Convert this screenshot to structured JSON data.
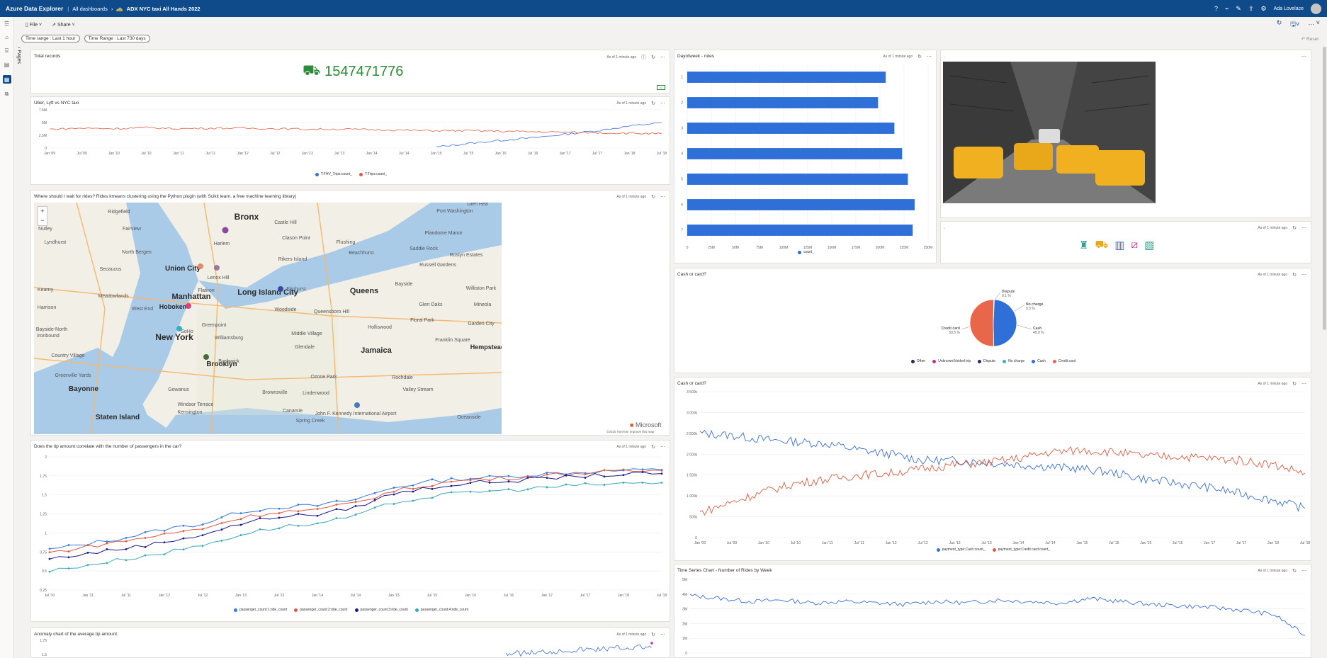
{
  "app": {
    "title": "Azure Data Explorer",
    "breadcrumb_root": "All dashboards",
    "dashboard_name": "ADX NYC taxi All Hands 2022",
    "user": "Ada Lovelace"
  },
  "toolbar": {
    "file": "File",
    "share": "Share"
  },
  "filters": {
    "time_range": "Time range : Last 1 hour",
    "time_range2": "Time Range : Last 730 days",
    "reset": "Reset"
  },
  "rail": {
    "pages": "Pages"
  },
  "tiles": {
    "total": {
      "title": "Total records",
      "meta": "As of 1 minute ago",
      "value": "1547471776"
    },
    "uber": {
      "title": "Uber, Lyft vs NYC taxi",
      "meta": "As of 1 minute ago"
    },
    "map": {
      "title": "Where should I wait for rides? Rides kmeans clustering using the Python plugin (with Scikit learn, a free machine learning library)",
      "meta": "As of 1 minute ago",
      "brand": "Microsoft",
      "copyright": "©2020 TomTom Improve this map"
    },
    "tip": {
      "title": "Does the tip amount correlate with the number of passengers in the car?",
      "meta": "As of 1 minute ago"
    },
    "anomaly": {
      "title": "Anomaly chart of the average tip amount.",
      "meta": "As of 1 minute ago"
    },
    "dow": {
      "title": "Dayofweek - rides",
      "meta": "As of 1 minute ago"
    },
    "image": {
      "title": ".",
      "meta": ""
    },
    "icons": {
      "title": ".",
      "meta": "As of 1 minute ago"
    },
    "pie": {
      "title": "Cash or card?",
      "meta": "As of 1 minute ago"
    },
    "cashline": {
      "title": "Cash or card?",
      "meta": "As of 1 minute ago"
    },
    "weekly": {
      "title": "Time Series Chart - Number of Rides by Week",
      "meta": "As of 1 minute ago"
    }
  },
  "map_labels": [
    "Bronx",
    "Harlem",
    "Manhattan",
    "Union City",
    "Long Island City",
    "Queens",
    "Hoboken",
    "New York",
    "Brooklyn",
    "Jamaica",
    "Bayonne",
    "Staten Island",
    "Castle Hill",
    "Flushing",
    "Elmhurst",
    "Woodside",
    "Port Washington",
    "Plandome Manor",
    "Saddle Rock",
    "Roslyn Estates",
    "Russell Gardens",
    "Beachhurst",
    "Bayside",
    "Glen Oaks",
    "Floral Park",
    "Mineola",
    "Garden City",
    "Franklin Square",
    "Hempstead",
    "Williston Park",
    "Nutley",
    "Lyndhurst",
    "Kearny",
    "Ridgefield",
    "Fairview",
    "Secaucus",
    "North Bergen",
    "Meadowlands",
    "Harrison",
    "West End",
    "Flatiron",
    "Greenpoint",
    "Williamsburg",
    "Middle Village",
    "Glendale",
    "Hollis",
    "Queensboro Hill",
    "Holliswood",
    "Bushwick",
    "Ozone Park",
    "Rochdale",
    "Valley Stream",
    "Brownsville",
    "Lindenwood",
    "Canarsie",
    "Spring Creek",
    "John F. Kennedy International Airport",
    "Oceanside",
    "Kensington",
    "Gowanus",
    "Windsor Terrace",
    "Greenville Yards",
    "Country Village",
    "Bayside-North",
    "Ironbound",
    "Lenox Hill",
    "Rikers Island",
    "Clason Point",
    "SoHo",
    "Bushwick",
    "Glen Hea"
  ],
  "chart_data": [
    {
      "type": "line",
      "title": "Uber, Lyft vs NYC taxi",
      "categories": [
        "Jan '09",
        "Jul '09",
        "Jan '10",
        "Jul '10",
        "Jan '11",
        "Jul '11",
        "Jan '12",
        "Jul '12",
        "Jan '13",
        "Jul '13",
        "Jan '14",
        "Jul '14",
        "Jan '15",
        "Jul '15",
        "Jan '16",
        "Jul '16",
        "Jan '17",
        "Jul '17",
        "Jan '18",
        "Jul '18"
      ],
      "yticks": [
        "7.5M",
        "5M",
        "2.5M",
        "0"
      ],
      "ylim": [
        0,
        7.5
      ],
      "series": [
        {
          "name": "T:FHV_Trips:count_",
          "color": "#3a6fd8",
          "values": [
            null,
            null,
            null,
            null,
            null,
            null,
            null,
            null,
            null,
            null,
            null,
            null,
            0.2,
            0.9,
            1.5,
            2.0,
            2.7,
            3.4,
            4.3,
            5.0
          ]
        },
        {
          "name": "T:Trips:count_",
          "color": "#e05b40",
          "values": [
            3.7,
            3.9,
            3.8,
            4.0,
            3.8,
            3.9,
            3.9,
            3.8,
            3.7,
            3.7,
            3.6,
            3.5,
            3.4,
            3.4,
            3.3,
            3.2,
            3.1,
            3.0,
            2.9,
            2.8
          ]
        }
      ]
    },
    {
      "type": "line",
      "title": "Does the tip amount correlate with the number of passengers in the car?",
      "categories": [
        "Jul '10",
        "Jan '11",
        "Jul '11",
        "Jan '12",
        "Jul '12",
        "Jan '13",
        "Jul '13",
        "Jan '14",
        "Jul '14",
        "Jan '15",
        "Jul '15",
        "Jan '16",
        "Jul '16",
        "Jan '17",
        "Jul '17",
        "Jan '18",
        "Jul '18"
      ],
      "yticks": [
        "2",
        "1.75",
        "1.5",
        "1.25",
        "1",
        "0.75",
        "0.5",
        "0.25"
      ],
      "ylim": [
        0.25,
        2
      ],
      "series": [
        {
          "name": "passenger_count:1:ride_count",
          "color": "#3a7ad8",
          "values": [
            0.78,
            0.86,
            0.94,
            1.05,
            1.12,
            1.28,
            1.34,
            1.36,
            1.44,
            1.6,
            1.68,
            1.72,
            1.74,
            1.78,
            1.8,
            1.82,
            1.83
          ]
        },
        {
          "name": "passenger_count:2:ride_count",
          "color": "#e05b40",
          "values": [
            0.74,
            0.82,
            0.9,
            0.98,
            1.06,
            1.2,
            1.28,
            1.3,
            1.4,
            1.55,
            1.64,
            1.7,
            1.72,
            1.76,
            1.79,
            1.81,
            1.82
          ]
        },
        {
          "name": "passenger_count:3:ride_count",
          "color": "#1a1a8a",
          "values": [
            0.66,
            0.73,
            0.8,
            0.88,
            0.98,
            1.12,
            1.22,
            1.24,
            1.34,
            1.52,
            1.6,
            1.66,
            1.68,
            1.72,
            1.75,
            1.77,
            1.78
          ]
        },
        {
          "name": "passenger_count:4:ride_count",
          "color": "#3aa8b8",
          "values": [
            0.5,
            0.58,
            0.66,
            0.74,
            0.84,
            0.98,
            1.08,
            1.12,
            1.22,
            1.4,
            1.48,
            1.54,
            1.56,
            1.6,
            1.63,
            1.65,
            1.66
          ]
        }
      ]
    },
    {
      "type": "line",
      "title": "Anomaly chart of the average tip amount.",
      "yticks": [
        "1.75",
        "1.5"
      ],
      "ylim": [
        1.4,
        1.8
      ],
      "series": [
        {
          "name": "avg tip",
          "color": "#3a6fd8",
          "values": [
            1.5,
            1.52,
            1.55,
            1.58,
            1.6,
            1.62,
            1.64,
            1.66
          ]
        }
      ]
    },
    {
      "type": "bar",
      "orientation": "horizontal",
      "title": "Dayofweek - rides",
      "categories": [
        "1",
        "2",
        "3",
        "4",
        "5",
        "6",
        "7"
      ],
      "series": [
        {
          "name": "count_",
          "color": "#2f6fd8",
          "values": [
            206,
            198,
            215,
            223,
            229,
            236,
            234
          ]
        }
      ],
      "xticks": [
        "0",
        "25M",
        "50M",
        "75M",
        "100M",
        "125M",
        "150M",
        "175M",
        "200M",
        "225M",
        "250M"
      ],
      "xlim": [
        0,
        250
      ],
      "unit": "M"
    },
    {
      "type": "pie",
      "title": "Cash or card?",
      "slices": [
        {
          "label": "Other",
          "value": 0.0,
          "color": "#3b1f4a"
        },
        {
          "label": "Unknown/Voided trip",
          "value": 0.0,
          "color": "#c0338a"
        },
        {
          "label": "Dispute",
          "value": 0.1,
          "color": "#1f2a6a"
        },
        {
          "label": "No charge",
          "value": 0.3,
          "color": "#3ab0c0"
        },
        {
          "label": "Cash",
          "value": 49.0,
          "color": "#2f6fd8"
        },
        {
          "label": "Credit card",
          "value": 50.5,
          "color": "#e8674a"
        }
      ],
      "callouts": [
        {
          "name": "Dispute",
          "pct": "0.1 %"
        },
        {
          "name": "No charge",
          "pct": "0.3 %"
        },
        {
          "name": "Cash",
          "pct": "49.0 %"
        },
        {
          "name": "Credit card",
          "pct": "50.5 %"
        }
      ]
    },
    {
      "type": "line",
      "title": "Cash or card?",
      "categories": [
        "Jan '09",
        "Jul '09",
        "Jan '10",
        "Jul '10",
        "Jan '11",
        "Jul '11",
        "Jan '12",
        "Jul '12",
        "Jan '13",
        "Jul '13",
        "Jan '14",
        "Jul '14",
        "Jan '15",
        "Jul '15",
        "Jan '16",
        "Jul '16",
        "Jan '17",
        "Jul '17",
        "Jan '18",
        "Jul '18"
      ],
      "yticks": [
        "3 500k",
        "3 000k",
        "2 500k",
        "2 000k",
        "1 500k",
        "1 000k",
        "500k",
        "0"
      ],
      "ylim": [
        0,
        3500
      ],
      "series": [
        {
          "name": "payment_type:Cash:count_",
          "color": "#3a6fd8",
          "values": [
            2500,
            2450,
            2350,
            2300,
            2250,
            2100,
            2000,
            1850,
            1850,
            1800,
            1750,
            1700,
            1650,
            1550,
            1400,
            1300,
            1200,
            1050,
            900,
            700
          ]
        },
        {
          "name": "payment_type:Credit card:count_",
          "color": "#e05b40",
          "values": [
            600,
            850,
            1100,
            1300,
            1400,
            1500,
            1550,
            1650,
            1750,
            1800,
            1900,
            2050,
            2100,
            2050,
            1950,
            1950,
            1900,
            1850,
            1750,
            1550
          ]
        }
      ]
    },
    {
      "type": "line",
      "title": "Time Series Chart - Number of Rides by Week",
      "yticks": [
        "5M",
        "4M",
        "3M",
        "2M",
        "1M",
        "0"
      ],
      "ylim": [
        0,
        5
      ],
      "series": [
        {
          "name": "rides",
          "color": "#3a6fd8",
          "values": [
            3.9,
            3.7,
            3.5,
            3.6,
            3.4,
            3.5,
            3.4,
            3.3,
            3.5,
            3.4,
            3.6,
            3.5,
            3.4,
            3.7,
            3.5,
            3.3,
            3.2,
            3.1,
            2.9,
            2.6,
            1.2
          ]
        }
      ]
    }
  ]
}
